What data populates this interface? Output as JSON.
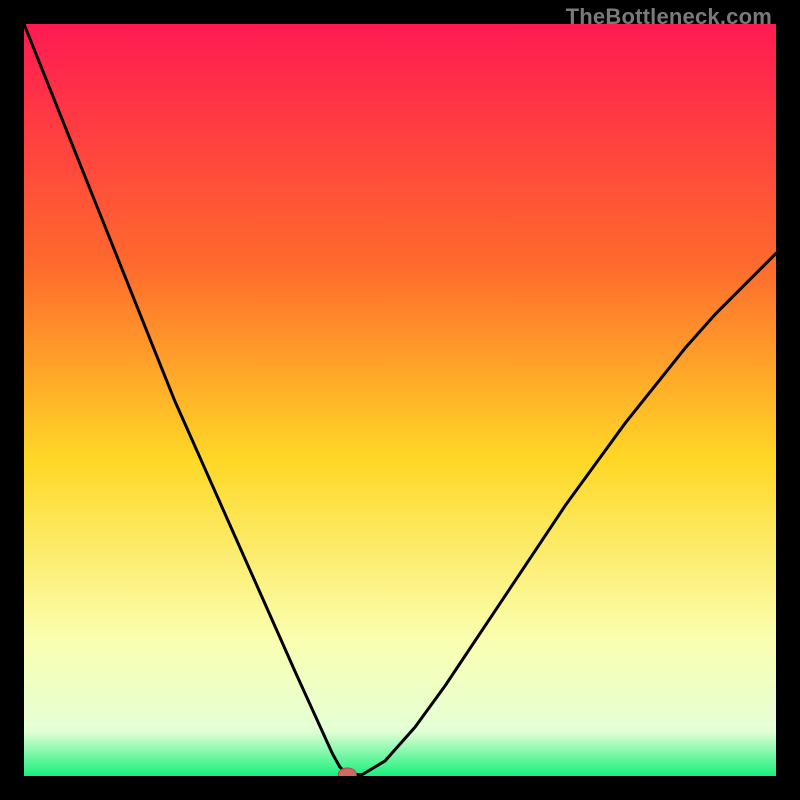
{
  "watermark": "TheBottleneck.com",
  "colors": {
    "frame": "#000000",
    "grad_top": "#ff1a52",
    "grad_25": "#ff6a2d",
    "grad_50": "#ffd826",
    "grad_75": "#faffb1",
    "grad_90": "#e4ffd6",
    "grad_bottom": "#18f07a",
    "curve": "#000000",
    "marker_fill": "#cf6a61",
    "marker_stroke": "#a94c4c"
  },
  "chart_data": {
    "type": "line",
    "title": "",
    "xlabel": "",
    "ylabel": "",
    "xlim": [
      0,
      100
    ],
    "ylim": [
      0,
      100
    ],
    "series": [
      {
        "name": "bottleneck-curve",
        "x": [
          0,
          2,
          4,
          6,
          8,
          10,
          12,
          14,
          16,
          18,
          20,
          22,
          24,
          26,
          28,
          30,
          32,
          34,
          36,
          38,
          40,
          41,
          42,
          43,
          45,
          48,
          52,
          56,
          60,
          64,
          68,
          72,
          76,
          80,
          84,
          88,
          92,
          96,
          100
        ],
        "y": [
          100,
          95,
          90,
          85,
          80,
          75,
          70,
          65,
          60,
          55,
          50,
          45.5,
          41,
          36.5,
          32,
          27.5,
          23,
          18.5,
          14,
          9.6,
          5.2,
          3,
          1.2,
          0.2,
          0.2,
          2,
          6.5,
          12,
          18,
          24,
          30,
          36,
          41.5,
          47,
          52,
          57,
          61.5,
          65.5,
          69.5
        ]
      }
    ],
    "marker": {
      "x": 43,
      "y": 0.2
    }
  }
}
